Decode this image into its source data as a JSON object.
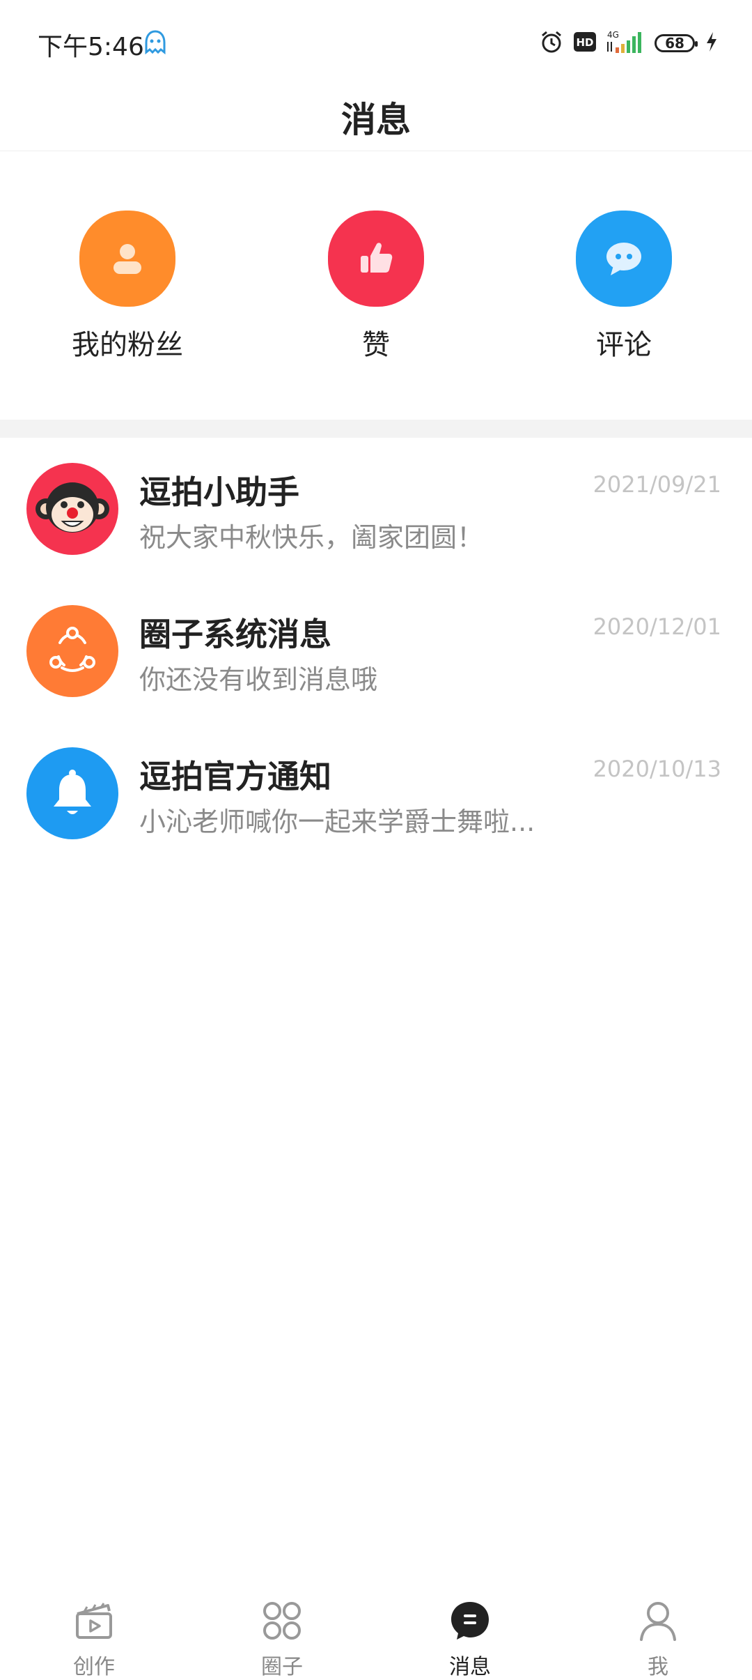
{
  "status_bar": {
    "time": "下午5:46",
    "battery": "68",
    "icons": [
      "ghost-notification-icon",
      "alarm-icon",
      "hd-icon",
      "signal-4g-icon",
      "battery-icon",
      "charging-icon"
    ]
  },
  "header": {
    "title": "消息"
  },
  "quick_entries": [
    {
      "label": "我的粉丝",
      "icon": "user-icon",
      "color": "#FF8C2B"
    },
    {
      "label": "赞",
      "icon": "thumbs-up-icon",
      "color": "#F5334F"
    },
    {
      "label": "评论",
      "icon": "comment-bubble-icon",
      "color": "#22A1F3"
    }
  ],
  "messages": [
    {
      "title": "逗拍小助手",
      "subtitle": "祝大家中秋快乐，阖家团圆！",
      "date": "2021/09/21",
      "icon": "monkey-avatar-icon",
      "color": "#F5334F"
    },
    {
      "title": "圈子系统消息",
      "subtitle": "你还没有收到消息哦",
      "date": "2020/12/01",
      "icon": "circle-network-icon",
      "color": "#FF7B35"
    },
    {
      "title": "逗拍官方通知",
      "subtitle": "小沁老师喊你一起来学爵士舞啦...",
      "date": "2020/10/13",
      "icon": "bell-icon",
      "color": "#1E9BF2"
    }
  ],
  "bottom_nav": {
    "active": "消息",
    "items": [
      {
        "label": "创作",
        "icon": "clapperboard-icon"
      },
      {
        "label": "圈子",
        "icon": "four-circles-icon"
      },
      {
        "label": "消息",
        "icon": "message-bubble-icon"
      },
      {
        "label": "我",
        "icon": "person-icon"
      }
    ]
  }
}
